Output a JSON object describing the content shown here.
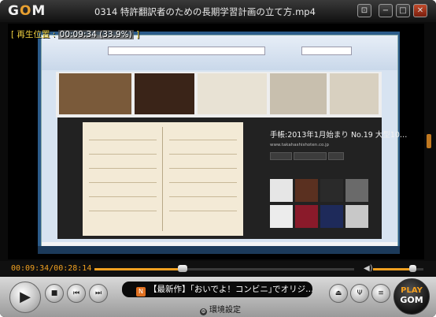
{
  "window": {
    "logo_main": "G",
    "logo_o": "O",
    "logo_end": "M",
    "title": "0314 特許翻訳者のための長期学習計画の立て方.mp4",
    "buttons": {
      "compact": "⊡",
      "minimize": "−",
      "maximize": "□",
      "close": "✕"
    }
  },
  "video": {
    "osd_label": "[ 再生位置 :",
    "osd_time": "00:09:34 (33.9%)",
    "osd_end": "]",
    "overlay_title": "手帳:2013年1月始まり No.19 大型10…",
    "overlay_source": "www.takahashishoten.co.jp"
  },
  "seekbar": {
    "time": "00:09:34/00:28:14",
    "progress_fraction": 0.339,
    "volume_fraction": 0.78
  },
  "controls": {
    "play_icon": "▶",
    "stop_icon": "■",
    "prev_icon": "⏮",
    "next_icon": "⏭",
    "ticker_text": "【最新作】｢おいでよ！コンビニ｣でオリジ…",
    "ticker_icon": "N",
    "eject_icon": "⏏",
    "subtitle_icon": "Ψ",
    "menu_icon": "≡",
    "settings_label": "環境設定",
    "settings_icon": "⚙",
    "playgom_line1": "PLAY",
    "playgom_line2": "GOM"
  },
  "colors": {
    "accent": "#f0a020",
    "osd": "#f0d040"
  }
}
